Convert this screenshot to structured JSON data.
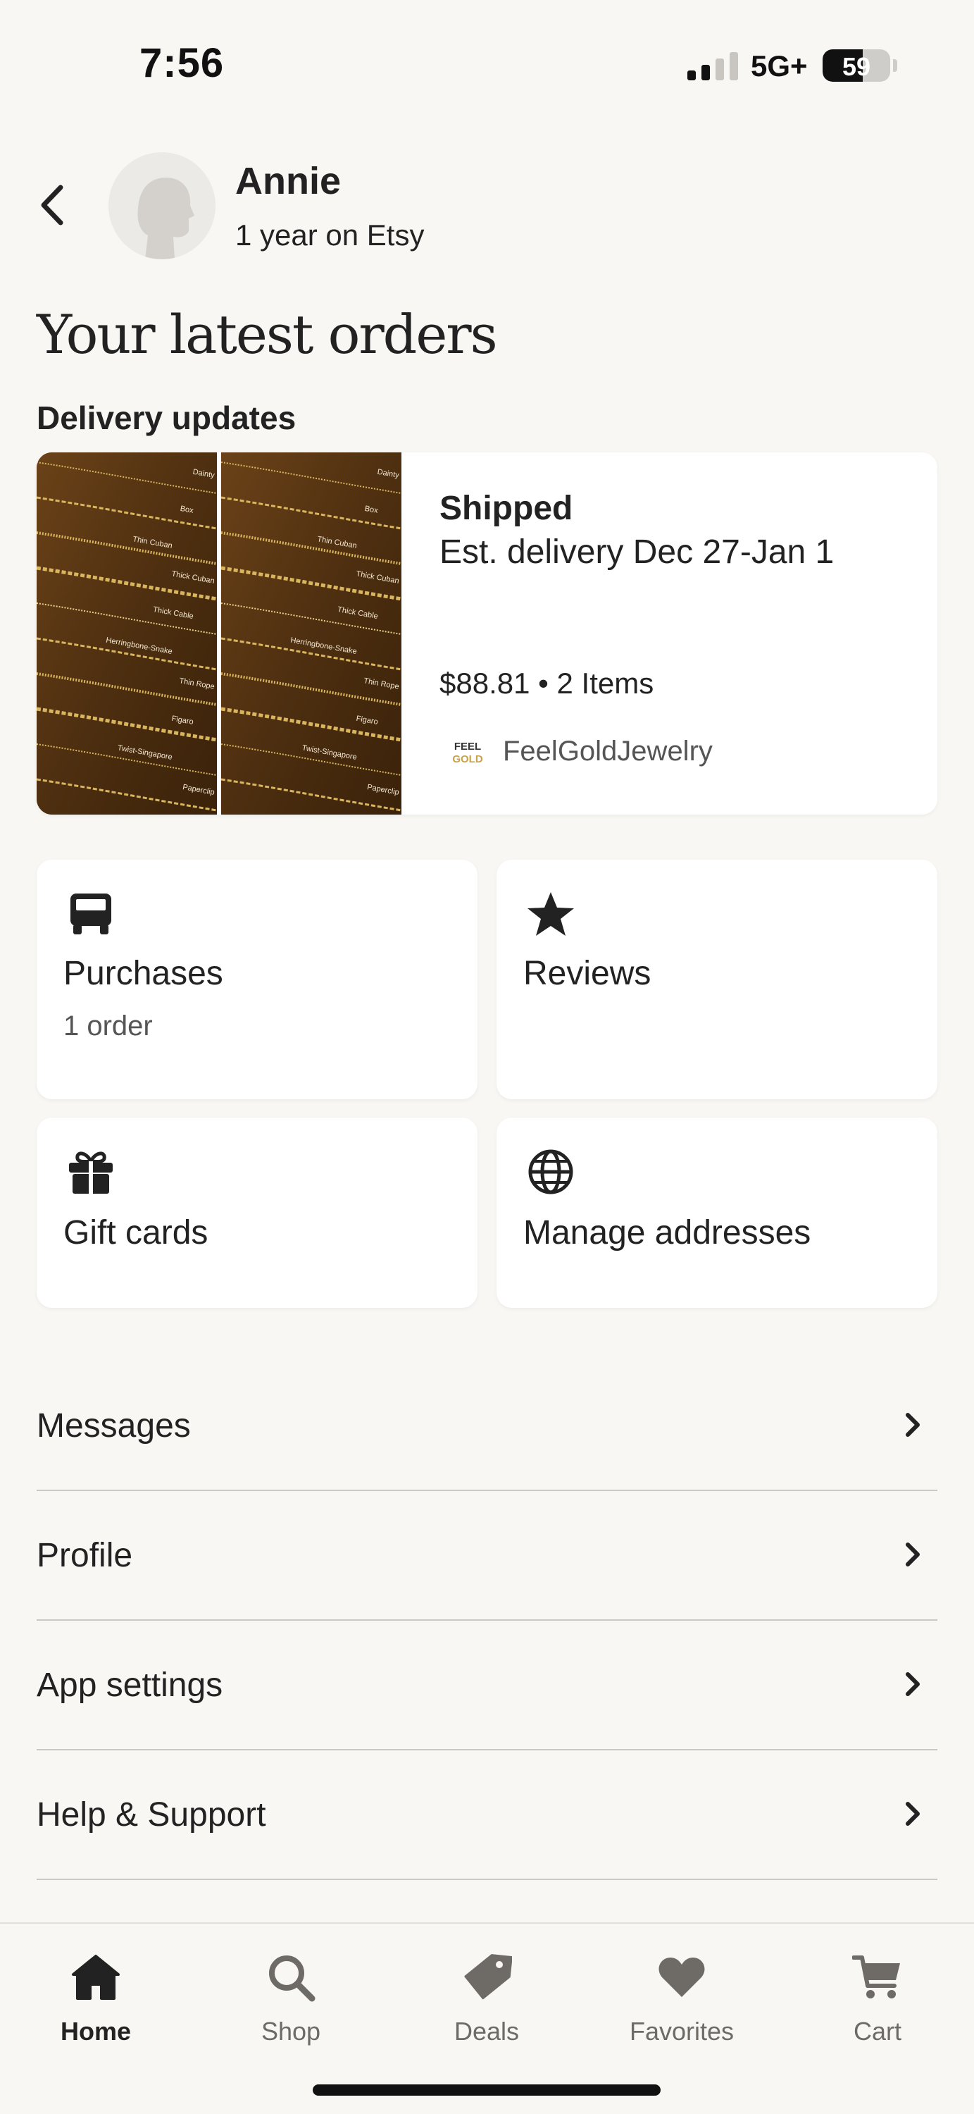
{
  "status_bar": {
    "time": "7:56",
    "network": "5G+",
    "battery": "59",
    "battery_level": 0.59
  },
  "header": {
    "user_name": "Annie",
    "tenure": "1 year on Etsy",
    "back_icon": "chevron-left-icon",
    "avatar_icon": "default-avatar-icon"
  },
  "page_title": "Your latest orders",
  "delivery_section": {
    "label": "Delivery updates"
  },
  "order": {
    "status": "Shipped",
    "delivery": "Est. delivery Dec 27-Jan 1",
    "summary": "$88.81 • 2 Items",
    "shop_name": "FeelGoldJewelry",
    "shop_logo": {
      "line1": "FEEL",
      "line2": "GOLD"
    },
    "chain_labels": [
      "Dainty",
      "Box",
      "Thin Cuban",
      "Thick Cuban",
      "Thick Cable",
      "Herringbone-Snake",
      "Thin Rope",
      "Figaro",
      "Twist-Singapore",
      "Paperclip"
    ]
  },
  "tiles": [
    {
      "label": "Purchases",
      "sub": "1 order",
      "icon": "truck-icon"
    },
    {
      "label": "Reviews",
      "sub": "",
      "icon": "star-icon"
    },
    {
      "label": "Gift cards",
      "sub": "",
      "icon": "gift-icon"
    },
    {
      "label": "Manage addresses",
      "sub": "",
      "icon": "globe-icon"
    }
  ],
  "menu": [
    {
      "label": "Messages"
    },
    {
      "label": "Profile"
    },
    {
      "label": "App settings"
    },
    {
      "label": "Help & Support"
    }
  ],
  "bottom_nav": [
    {
      "label": "Home",
      "icon": "home-icon",
      "active": true
    },
    {
      "label": "Shop",
      "icon": "search-icon",
      "active": false
    },
    {
      "label": "Deals",
      "icon": "tag-icon",
      "active": false
    },
    {
      "label": "Favorites",
      "icon": "heart-icon",
      "active": false
    },
    {
      "label": "Cart",
      "icon": "cart-icon",
      "active": false
    }
  ],
  "colors": {
    "background": "#F8F7F3",
    "text": "#222222",
    "muted": "#6E6A65",
    "card": "#FFFFFF",
    "divider": "#CCC8C4"
  }
}
